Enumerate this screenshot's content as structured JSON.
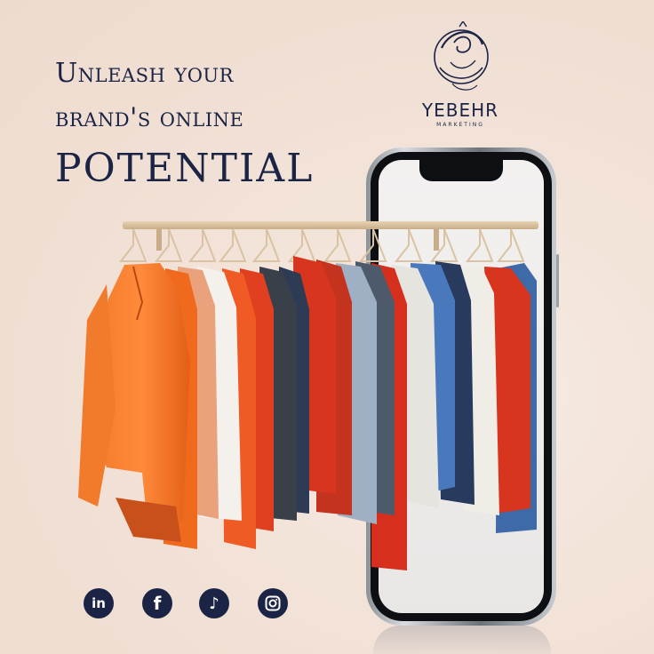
{
  "headline": {
    "line1": "Unleash your",
    "line2": "brand's online",
    "line3": "POTENTIAL"
  },
  "logo": {
    "name": "YEBEHR",
    "subtitle": "MARKETING",
    "icon": "yebehr-logo-emblem"
  },
  "socials": [
    {
      "name": "LinkedIn",
      "icon": "linkedin-icon",
      "glyph": "in"
    },
    {
      "name": "Facebook",
      "icon": "facebook-icon",
      "glyph": "f"
    },
    {
      "name": "TikTok",
      "icon": "tiktok-icon",
      "glyph": "♪"
    },
    {
      "name": "Instagram",
      "icon": "instagram-icon",
      "glyph": ""
    }
  ],
  "colors": {
    "background": "#f4e6dc",
    "text": "#1b2444",
    "accent_orange": "#f06a1e",
    "accent_red": "#d8351f"
  },
  "image": {
    "subject": "clothing-rack-with-smartphone"
  }
}
